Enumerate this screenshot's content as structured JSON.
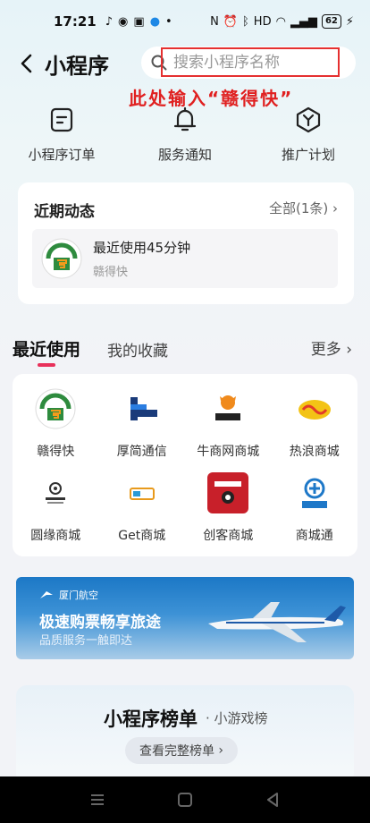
{
  "status_bar": {
    "time": "17:21",
    "battery": "62"
  },
  "header": {
    "title": "小程序",
    "search_placeholder": "搜索小程序名称"
  },
  "annotation": "此处输入“赣得快”",
  "quick_actions": [
    {
      "label": "小程序订单",
      "icon": "order-icon"
    },
    {
      "label": "服务通知",
      "icon": "bell-icon"
    },
    {
      "label": "推广计划",
      "icon": "promo-icon"
    }
  ],
  "recent_activity": {
    "title": "近期动态",
    "all_label": "全部(1条)",
    "item": {
      "text": "最近使用45分钟",
      "name": "赣得快"
    }
  },
  "tabs": {
    "recent": "最近使用",
    "favorites": "我的收藏",
    "more": "更多"
  },
  "apps": [
    {
      "label": "赣得快",
      "icon": "gandekuai-logo"
    },
    {
      "label": "厚简通信",
      "icon": "houjian-logo"
    },
    {
      "label": "牛商网商城",
      "icon": "niushang-logo"
    },
    {
      "label": "热浪商城",
      "icon": "relang-logo"
    },
    {
      "label": "圆缘商城",
      "icon": "yuanyuan-logo"
    },
    {
      "label": "Get商城",
      "icon": "get-logo"
    },
    {
      "label": "创客商城",
      "icon": "makers-logo"
    },
    {
      "label": "商城通",
      "icon": "shangchengtong-logo"
    }
  ],
  "banner": {
    "brand": "厦门航空",
    "headline": "极速购票畅享旅途",
    "subline": "品质服务一触即达"
  },
  "ranking": {
    "title": "小程序榜单",
    "subtitle": "· 小游戏榜",
    "button": "查看完整榜单"
  },
  "colors": {
    "accent_pink": "#e8305a",
    "annotation_red": "#e02020",
    "banner_blue": "#1c78c6"
  }
}
